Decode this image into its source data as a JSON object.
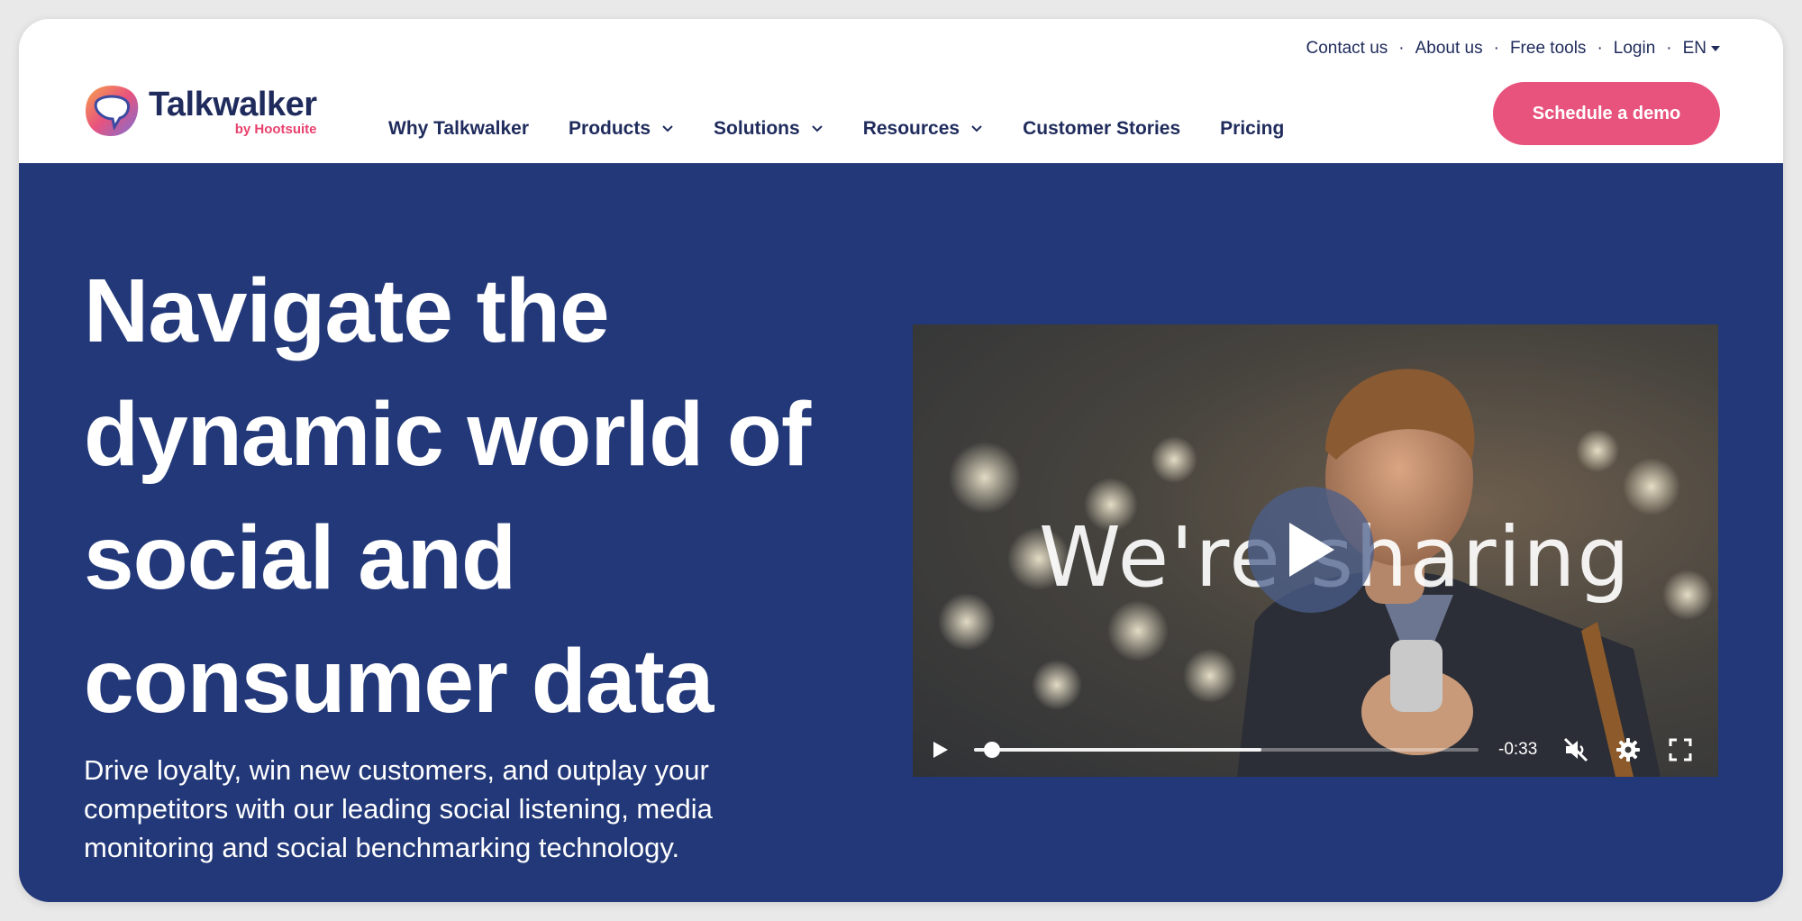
{
  "header": {
    "utility_links": [
      {
        "label": "Contact us"
      },
      {
        "label": "About us"
      },
      {
        "label": "Free tools"
      },
      {
        "label": "Login"
      }
    ],
    "separator": "·",
    "language": "EN",
    "logo": {
      "name": "Talkwalker",
      "sub": "by Hootsuite"
    },
    "nav": [
      {
        "label": "Why Talkwalker",
        "dropdown": false
      },
      {
        "label": "Products",
        "dropdown": true
      },
      {
        "label": "Solutions",
        "dropdown": true
      },
      {
        "label": "Resources",
        "dropdown": true
      },
      {
        "label": "Customer Stories",
        "dropdown": false
      },
      {
        "label": "Pricing",
        "dropdown": false
      }
    ],
    "cta_label": "Schedule a demo"
  },
  "hero": {
    "title_lines": [
      "Navigate the",
      "dynamic world of",
      "social and",
      "consumer data"
    ],
    "subtitle_lines": [
      "Drive loyalty, win new customers, and outplay your",
      "competitors with our leading social listening, media",
      "monitoring and social benchmarking technology."
    ]
  },
  "video": {
    "caption": "We're sharing",
    "time_remaining": "-0:33",
    "progress": 0.02,
    "buffered": 0.57,
    "muted": true
  },
  "colors": {
    "navy": "#223879",
    "text_navy": "#1f2b5c",
    "accent_pink": "#e8537e",
    "white": "#ffffff"
  }
}
